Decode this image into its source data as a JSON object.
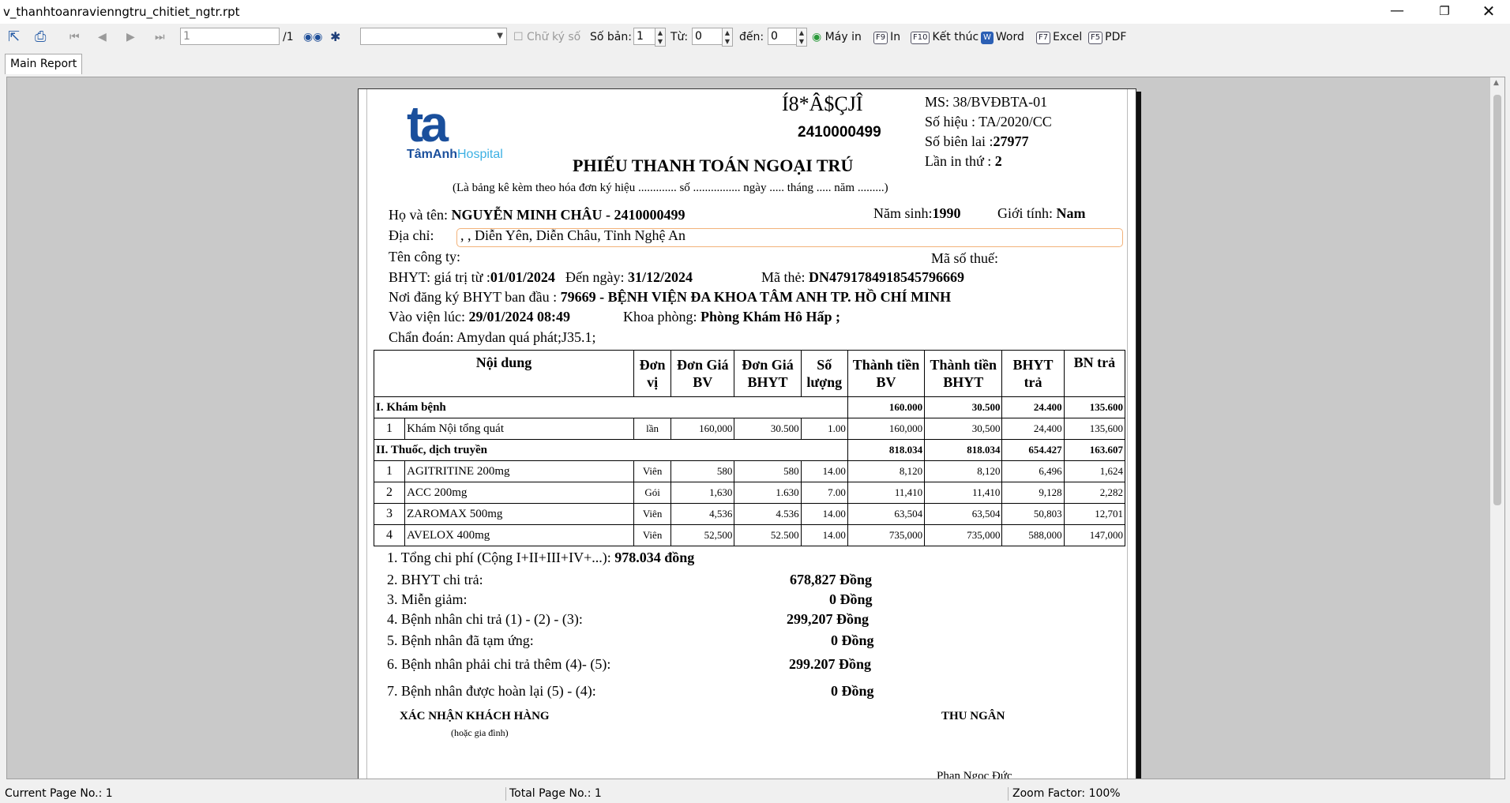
{
  "window": {
    "title": "v_thanhtoanravienngtru_chitiet_ngtr.rpt"
  },
  "toolbar": {
    "page_value": "1",
    "page_total": "/1",
    "sign_label": "Chữ ký số",
    "copies_label": "Số bản:",
    "copies_value": "1",
    "from_label": "Từ:",
    "from_value": "0",
    "to_label": "đến:",
    "to_value": "0",
    "printer_label": "Máy in",
    "print_key": "F9",
    "print_label": "In",
    "exit_key": "F10",
    "exit_label": "Kết thúc",
    "word_label": "Word",
    "excel_key": "F7",
    "excel_label": "Excel",
    "pdf_key": "F5",
    "pdf_label": "PDF"
  },
  "tab": {
    "label": "Main Report"
  },
  "report": {
    "logo_text": "ta",
    "logo_name_1": "TâmAnh",
    "logo_name_2": "Hospital",
    "barcode_text": "Í8*Â$ÇJÎ",
    "code": "2410000499",
    "ms": "MS: 38/BVĐBTA-01",
    "so_hieu": "Số hiệu : TA/2020/CC",
    "so_bien_lai_label": "Số biên lai :",
    "so_bien_lai": "27977",
    "lan_in_label": "Lần in thứ :",
    "lan_in": "2",
    "title": "PHIẾU THANH TOÁN NGOẠI TRÚ",
    "subtitle": "(Là bảng kê kèm theo hóa đơn ký hiệu ............. số ................ ngày ..... tháng ..... năm .........)",
    "name_label": "Họ và tên:",
    "name_value": "NGUYỄN MINH CHÂU - 2410000499",
    "birth_label": "Năm sinh:",
    "birth_value": "1990",
    "gender_label": "Giới tính:",
    "gender_value": "Nam",
    "address_label": "Địa chỉ:",
    "address_value": ", , Diễn Yên, Diễn Châu, Tỉnh Nghệ An",
    "company_label": "Tên công ty:",
    "tax_label": "Mã số thuế:",
    "bhyt_label": "BHYT: giá trị từ :",
    "bhyt_from": "01/01/2024",
    "bhyt_to_label": "Đến ngày:",
    "bhyt_to": "31/12/2024",
    "card_label": "Mã thẻ:",
    "card_value": "DN4791784918545796669",
    "reg_label": "Nơi đăng ký  BHYT ban đầu :",
    "reg_value": "79669 - BỆNH VIỆN ĐA KHOA TÂM ANH TP. HỒ CHÍ MINH",
    "admit_label": "Vào viện  lúc:",
    "admit_value": "29/01/2024 08:49",
    "dept_label": "Khoa phòng:",
    "dept_value": "Phòng Khám Hô Hấp ;",
    "diag_label": "Chẩn đoán:",
    "diag_value": "Amydan quá phát;J35.1;",
    "headers": {
      "content": "Nội dung",
      "unit_1": "Đơn",
      "unit_2": "vị",
      "price_bv_1": "Đơn Giá",
      "price_bv_2": "BV",
      "price_bhyt_1": "Đơn Giá",
      "price_bhyt_2": "BHYT",
      "qty_1": "Số",
      "qty_2": "lượng",
      "total_bv_1": "Thành tiền",
      "total_bv_2": "BV",
      "total_bhyt_1": "Thành tiền",
      "total_bhyt_2": "BHYT",
      "bhyt_pay_1": "BHYT",
      "bhyt_pay_2": "trả",
      "patient_pay": "BN trả"
    },
    "group1": {
      "name": "I. Khám bệnh",
      "total_bv": "160.000",
      "total_bhyt": "30.500",
      "bhyt_pay": "24.400",
      "patient_pay": "135.600"
    },
    "group1_rows": [
      {
        "idx": "1",
        "name": "Khám Nội tổng quát",
        "unit": "lần",
        "price_bv": "160,000",
        "price_bhyt": "30.500",
        "qty": "1.00",
        "total_bv": "160,000",
        "total_bhyt": "30,500",
        "bhyt_pay": "24,400",
        "patient_pay": "135,600"
      }
    ],
    "group2": {
      "name": "II. Thuốc, dịch truyền",
      "total_bv": "818.034",
      "total_bhyt": "818.034",
      "bhyt_pay": "654.427",
      "patient_pay": "163.607"
    },
    "group2_rows": [
      {
        "idx": "1",
        "name": "AGITRITINE 200mg",
        "unit": "Viên",
        "price_bv": "580",
        "price_bhyt": "580",
        "qty": "14.00",
        "total_bv": "8,120",
        "total_bhyt": "8,120",
        "bhyt_pay": "6,496",
        "patient_pay": "1,624"
      },
      {
        "idx": "2",
        "name": "ACC 200mg",
        "unit": "Gói",
        "price_bv": "1,630",
        "price_bhyt": "1.630",
        "qty": "7.00",
        "total_bv": "11,410",
        "total_bhyt": "11,410",
        "bhyt_pay": "9,128",
        "patient_pay": "2,282"
      },
      {
        "idx": "3",
        "name": "ZAROMAX 500mg",
        "unit": "Viên",
        "price_bv": "4,536",
        "price_bhyt": "4.536",
        "qty": "14.00",
        "total_bv": "63,504",
        "total_bhyt": "63,504",
        "bhyt_pay": "50,803",
        "patient_pay": "12,701"
      },
      {
        "idx": "4",
        "name": "AVELOX 400mg",
        "unit": "Viên",
        "price_bv": "52,500",
        "price_bhyt": "52.500",
        "qty": "14.00",
        "total_bv": "735,000",
        "total_bhyt": "735,000",
        "bhyt_pay": "588,000",
        "patient_pay": "147,000"
      }
    ],
    "summary": {
      "l1": "1. Tổng chi phí (Cộng I+II+III+IV+...):",
      "v1": "978.034 đồng",
      "l2": "2. BHYT chi trả:",
      "v2": "678,827  Đồng",
      "l3": "3. Miễn giảm:",
      "v3": "0  Đồng",
      "l4": "4. Bệnh nhân chi trả (1) - (2) - (3):",
      "v4": "299,207  Đồng",
      "l5": "5. Bệnh nhân đã tạm ứng:",
      "v5": "0 Đồng",
      "l6": "6. Bệnh nhân phải chi trả thêm (4)- (5):",
      "v6": "299.207 Đồng",
      "l7": "7. Bệnh nhân được hoàn lại (5) - (4):",
      "v7": "0 Đồng"
    },
    "customer_sign": "XÁC NHẬN KHÁCH HÀNG",
    "customer_sign_sub": "(hoặc gia đình)",
    "cashier": "THU NGÂN",
    "cashier_name": "Phan Ngọc Đức"
  },
  "status": {
    "current_page": "Current Page No.: 1",
    "total_page": "Total Page No.: 1",
    "zoom": "Zoom Factor: 100%"
  }
}
